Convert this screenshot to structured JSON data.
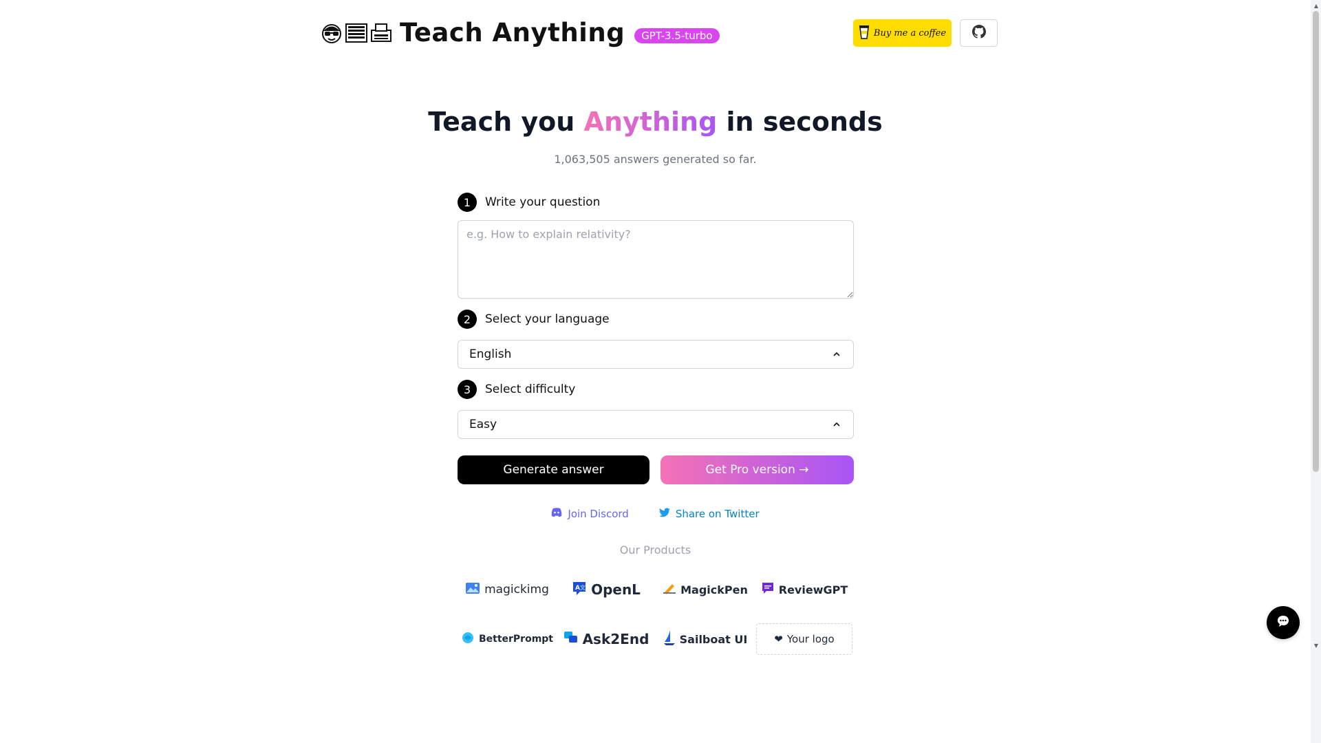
{
  "header": {
    "emoji_icons": [
      "nerd-face-icon",
      "abacus-icon",
      "printer-icon"
    ],
    "title": "Teach Anything",
    "model_badge": "GPT-3.5-turbo",
    "coffee_label": "Buy me a coffee",
    "github_icon": "github-icon"
  },
  "hero": {
    "title_before": "Teach you ",
    "title_accent": "Anything",
    "title_after": " in seconds",
    "subtitle": "1,063,505 answers generated so far."
  },
  "form": {
    "steps": [
      {
        "num": "1",
        "label": "Write your question"
      },
      {
        "num": "2",
        "label": "Select your language"
      },
      {
        "num": "3",
        "label": "Select difficulty"
      }
    ],
    "question_placeholder": "e.g. How to explain relativity?",
    "question_value": "",
    "language_value": "English",
    "difficulty_value": "Easy",
    "generate_label": "Generate answer",
    "pro_label": "Get Pro version →"
  },
  "links": {
    "discord": "Join Discord",
    "twitter": "Share on Twitter"
  },
  "products": {
    "title": "Our Products",
    "items": [
      {
        "name": "magickimg"
      },
      {
        "name": "OpenL"
      },
      {
        "name": "MagickPen"
      },
      {
        "name": "ReviewGPT"
      },
      {
        "name": "BetterPrompt"
      },
      {
        "name": "Ask2End"
      },
      {
        "name": "Sailboat UI"
      },
      {
        "name": "Your logo"
      }
    ]
  },
  "colors": {
    "badge": "#d946ef",
    "coffee": "#ffdd00",
    "accent_from": "#f472b6",
    "accent_to": "#a855f7",
    "discord": "#6366f1",
    "twitter": "#0284c7"
  }
}
